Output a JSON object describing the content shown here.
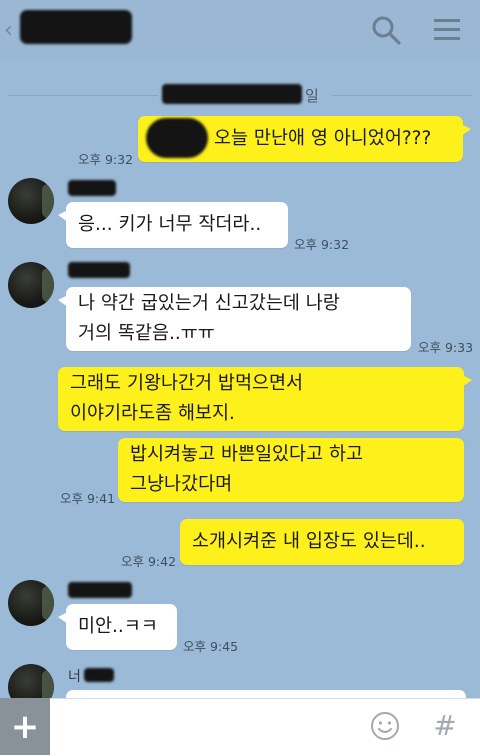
{
  "header": {
    "back_icon": "chevron-left-icon",
    "search_icon": "search-icon",
    "menu_icon": "hamburger-menu-icon"
  },
  "date_divider": {
    "suffix": "일"
  },
  "messages": [
    {
      "sender": "me",
      "text": "오늘 만난애 영 아니었어???",
      "time": "오후 9:32"
    },
    {
      "sender": "other",
      "text": "응... 키가 너무 작더라..",
      "time": "오후 9:32"
    },
    {
      "sender": "other",
      "lines": [
        "나 약간 굽있는거 신고갔는데 나랑",
        "거의 똑같음..ㅠㅠ"
      ],
      "time": "오후 9:33"
    },
    {
      "sender": "me",
      "lines": [
        "그래도 기왕나간거 밥먹으면서",
        "이야기라도좀 해보지."
      ]
    },
    {
      "sender": "me",
      "lines": [
        "밥시켜놓고 바쁜일있다고 하고",
        "그냥나갔다며"
      ],
      "time": "오후 9:41"
    },
    {
      "sender": "me",
      "text": "소개시켜준 내 입장도 있는데..",
      "time": "오후 9:42"
    },
    {
      "sender": "other",
      "text": "미안..ㅋㅋ",
      "time": "오후 9:45"
    }
  ],
  "last_sender_partial": "너",
  "input_bar": {
    "plus_label": "+",
    "placeholder": "",
    "emoji_icon": "smiley-icon",
    "hash_label": "#"
  },
  "colors": {
    "background": "#9bbad8",
    "my_bubble": "#fef01b",
    "other_bubble": "#ffffff"
  }
}
